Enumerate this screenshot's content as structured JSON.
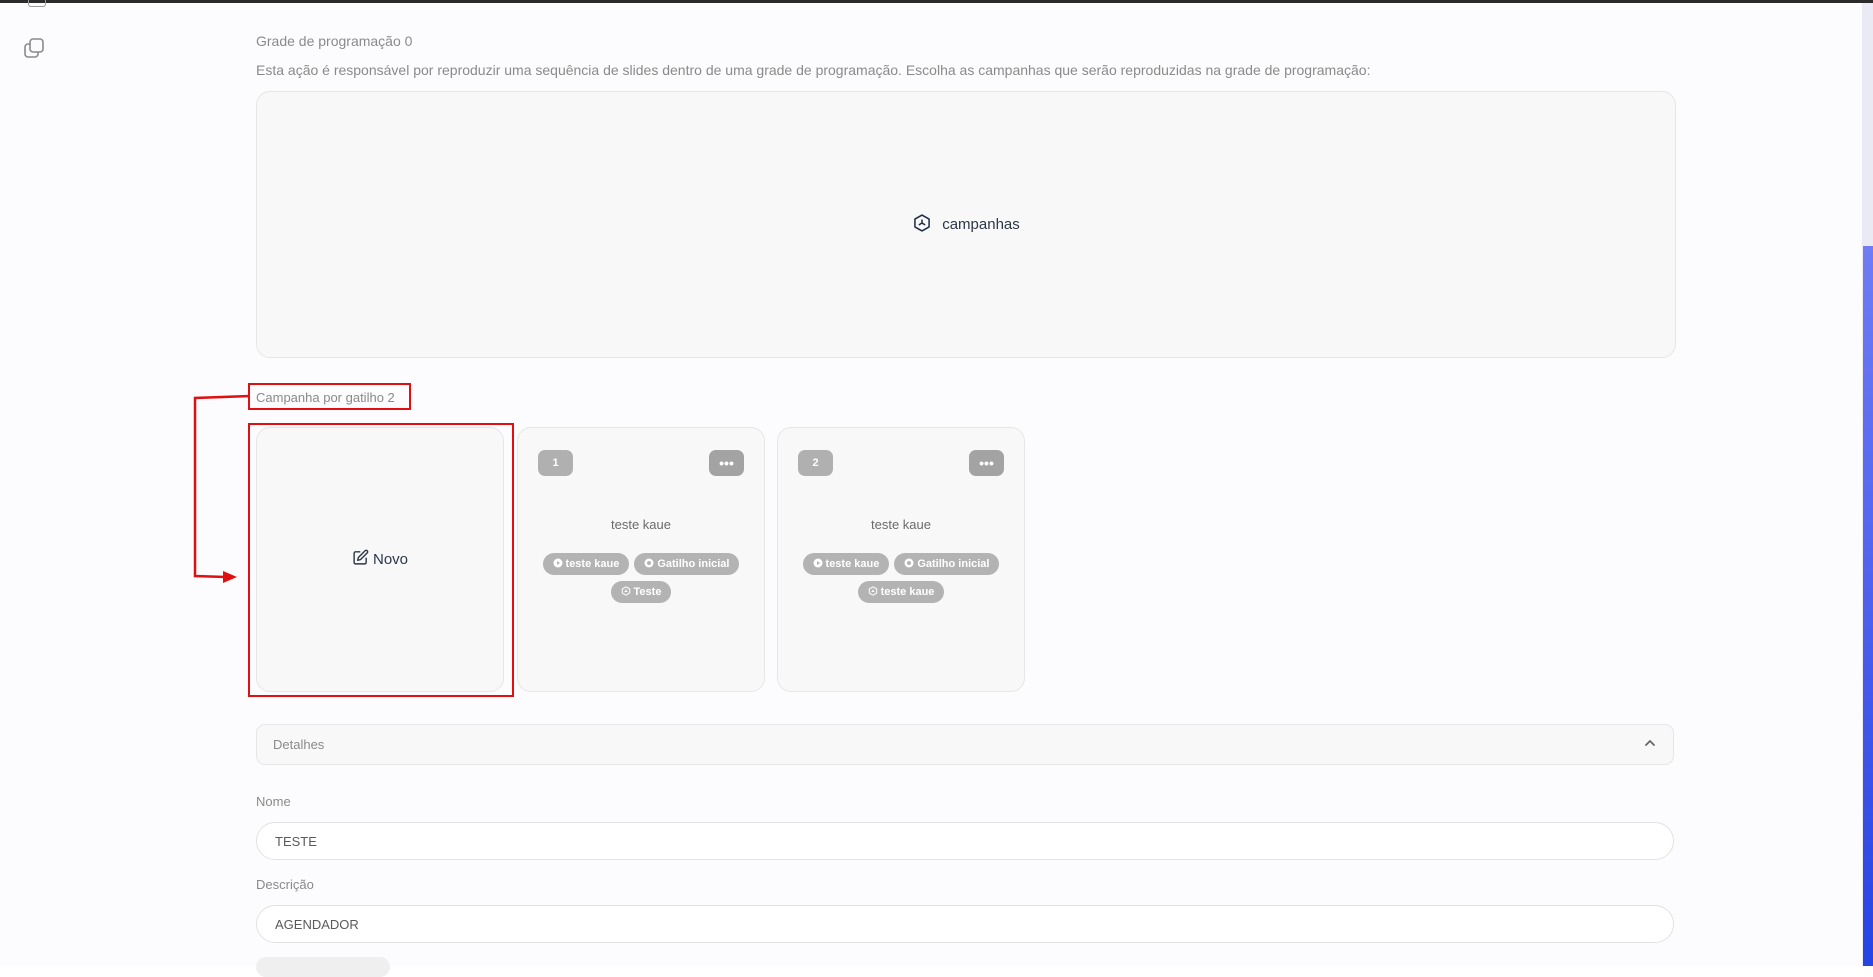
{
  "program_grid": {
    "title": "Grade de programação 0",
    "description": "Esta ação é responsável por reproduzir uma sequência de slides dentro de uma grade de programação. Escolha as campanhas que serão reproduzidas na grade de programação:",
    "campaigns_button": "campanhas",
    "campaigns_icon": "cube-icon"
  },
  "trigger_campaigns": {
    "title": "Campanha por gatilho 2",
    "new_label": "Novo",
    "new_icon": "edit-icon",
    "cards": [
      {
        "number": "1",
        "name": "teste kaue",
        "chips": [
          {
            "icon": "play-icon",
            "label": "teste kaue"
          },
          {
            "icon": "record-icon",
            "label": "Gatilho inicial"
          },
          {
            "icon": "cube-icon",
            "label": "Teste"
          }
        ]
      },
      {
        "number": "2",
        "name": "teste kaue",
        "chips": [
          {
            "icon": "play-icon",
            "label": "teste kaue"
          },
          {
            "icon": "record-icon",
            "label": "Gatilho inicial"
          },
          {
            "icon": "cube-icon",
            "label": "teste kaue"
          }
        ]
      }
    ],
    "menu_glyph": "•••"
  },
  "details": {
    "label": "Detalhes"
  },
  "form": {
    "name_label": "Nome",
    "name_value": "TESTE",
    "description_label": "Descrição",
    "description_value": "AGENDADOR"
  },
  "colors": {
    "annotation": "#e01010",
    "scrollbar": "#2643e4",
    "chip": "#b3b3b3"
  }
}
